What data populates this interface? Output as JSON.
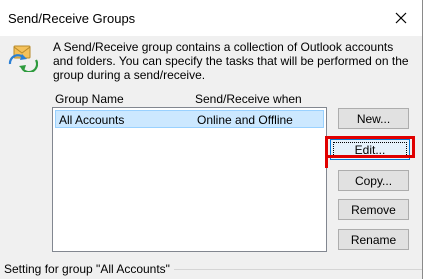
{
  "window": {
    "title": "Send/Receive Groups"
  },
  "description": "A Send/Receive group contains a collection of Outlook accounts and folders. You can specify the tasks that will be performed on the group during a send/receive.",
  "list": {
    "columns": [
      "Group Name",
      "Send/Receive when"
    ],
    "rows": [
      {
        "name": "All Accounts",
        "when": "Online and Offline"
      }
    ]
  },
  "buttons": {
    "new": "New...",
    "edit": "Edit...",
    "copy": "Copy...",
    "remove": "Remove",
    "rename": "Rename"
  },
  "settings_group_label": "Setting for group \"All Accounts\"",
  "colors": {
    "selection": "#cce8ff",
    "highlight": "#e00000",
    "dialog_bg": "#f0f0f0"
  },
  "icons": {
    "header": "send-receive-icon",
    "close": "close-icon"
  }
}
